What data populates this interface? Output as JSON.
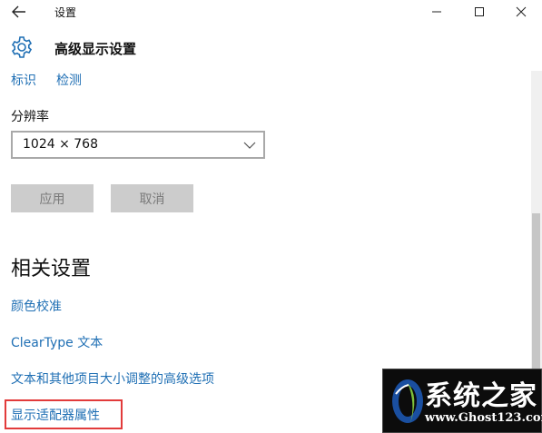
{
  "window": {
    "title": "设置",
    "back_icon": "arrow-left-icon",
    "controls": [
      "minimize-icon",
      "maximize-icon",
      "close-icon"
    ]
  },
  "header": {
    "title": "高级显示设置",
    "icon": "gear-icon"
  },
  "links_top": [
    "标识",
    "检测"
  ],
  "resolution": {
    "label": "分辨率",
    "value": "1024 × 768"
  },
  "buttons": {
    "apply": "应用",
    "cancel": "取消"
  },
  "related": {
    "title": "相关设置",
    "items": [
      "颜色校准",
      "ClearType 文本",
      "文本和其他项目大小调整的高级选项",
      "显示适配器属性"
    ]
  },
  "watermark": {
    "title": "系统之家",
    "url": "www.Ghost123.com"
  },
  "colors": {
    "link": "#1f6fb4",
    "highlight": "#e23b3b",
    "button_bg": "#cccccc"
  }
}
